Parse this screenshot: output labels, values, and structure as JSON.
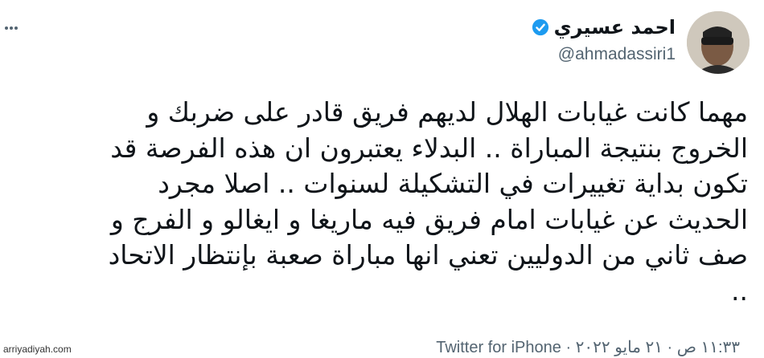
{
  "tweet": {
    "author": {
      "name": "احمد عسيري",
      "handle": "@ahmadassiri1",
      "verified": true,
      "verified_color": "#1d9bf0"
    },
    "text_lines": [
      "مهما كانت غيابات الهلال لديهم فريق قادر على ضربك و",
      "الخروج بنتيجة المباراة .. البدلاء يعتبرون ان هذه الفرصة قد",
      "تكون بداية تغييرات في التشكيلة لسنوات .. اصلا مجرد",
      "الحديث عن غيابات امام فريق فيه ماريغا و ايغالو و الفرج و",
      "صف ثاني من الدوليين تعني انها مباراة صعبة بإنتظار الاتحاد",
      ".."
    ],
    "timestamp": "١١:٣٣ ص · ٢١ مايو ٢٠٢٢",
    "separator": "·",
    "source": "Twitter for iPhone",
    "more_icon": "more-horizontal-icon"
  },
  "watermark": "arriyadiyah.com"
}
